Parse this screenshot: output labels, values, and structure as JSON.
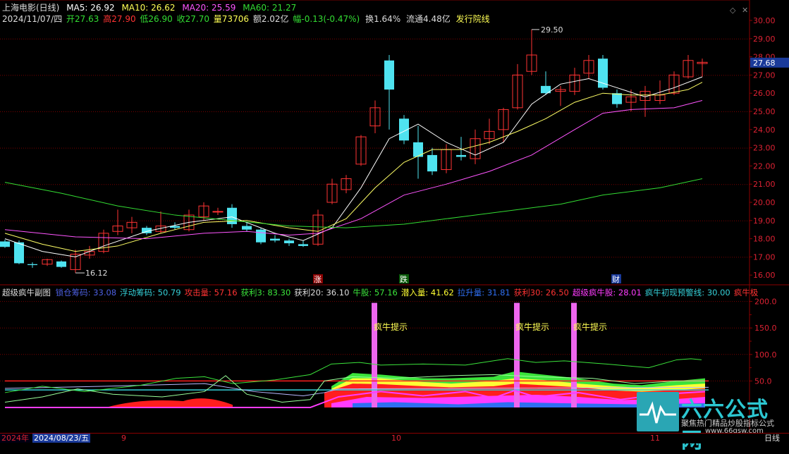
{
  "header": {
    "stock_title": "上海电影(日线)",
    "ma5": "MA5: 26.92",
    "ma10": "MA10: 26.62",
    "ma20": "MA20: 25.59",
    "ma60": "MA60: 21.27",
    "date": "2024/11/07/四",
    "open": "开27.63",
    "high": "高27.90",
    "low": "低26.90",
    "close": "收27.70",
    "volume": "量73706",
    "amount": "额2.02亿",
    "change": "幅-0.13(-0.47%)",
    "turnover": "换1.64%",
    "float": "流通4.48亿",
    "sector": "发行院线"
  },
  "sub_header": {
    "name": "超级疯牛副图",
    "items": [
      {
        "text": "锁仓筹码: 33.08",
        "color": "#4c5fe0"
      },
      {
        "text": "浮动筹码: 50.79",
        "color": "#35d0d8"
      },
      {
        "text": "攻击量: 57.16",
        "color": "#ff3333"
      },
      {
        "text": "获利3: 83.30",
        "color": "#3be33b"
      },
      {
        "text": "获利20: 36.10",
        "color": "#dddddd"
      },
      {
        "text": "牛股: 57.16",
        "color": "#3be33b"
      },
      {
        "text": "潜入量: 41.62",
        "color": "#ffff33"
      },
      {
        "text": "拉升量: 31.81",
        "color": "#2f6ff2"
      },
      {
        "text": "获利30: 26.50",
        "color": "#ff3333"
      },
      {
        "text": "超级疯牛股: 28.01",
        "color": "#ff3cff"
      },
      {
        "text": "疯牛初现预警线: 30.00",
        "color": "#35d0d8"
      },
      {
        "text": "疯牛极",
        "color": "#ff3333"
      }
    ]
  },
  "price_axis": [
    "30.00",
    "29.00",
    "28.00",
    "27.00",
    "26.00",
    "25.00",
    "24.00",
    "23.00",
    "22.00",
    "21.00",
    "20.00",
    "19.00",
    "18.00",
    "17.00",
    "16.00"
  ],
  "current_price": "27.68",
  "sub_axis": [
    "200.0",
    "150.0",
    "100.0",
    "50.0"
  ],
  "annotations": {
    "high_label": "29.50",
    "low_label": "16.12",
    "marker_zhang": "涨",
    "marker_die": "跌",
    "marker_cai": "财",
    "signal_text": "疯牛提示"
  },
  "bottom_bar": {
    "year": "2024年",
    "date": "2024/08/23/五",
    "m9": "9",
    "m10": "10",
    "m11": "11",
    "period": "日线"
  },
  "watermark": {
    "brand": "六六公式网",
    "slogan": "聚焦热门精品炒股指标公式",
    "url": "www.66gsw.com"
  },
  "colors": {
    "up": "#ff3333",
    "down": "#4fe3f0",
    "ma5": "#ffffff",
    "ma10": "#ffff66",
    "ma20": "#ff55ff",
    "ma60": "#33dd33",
    "grid": "#7a0000"
  }
}
